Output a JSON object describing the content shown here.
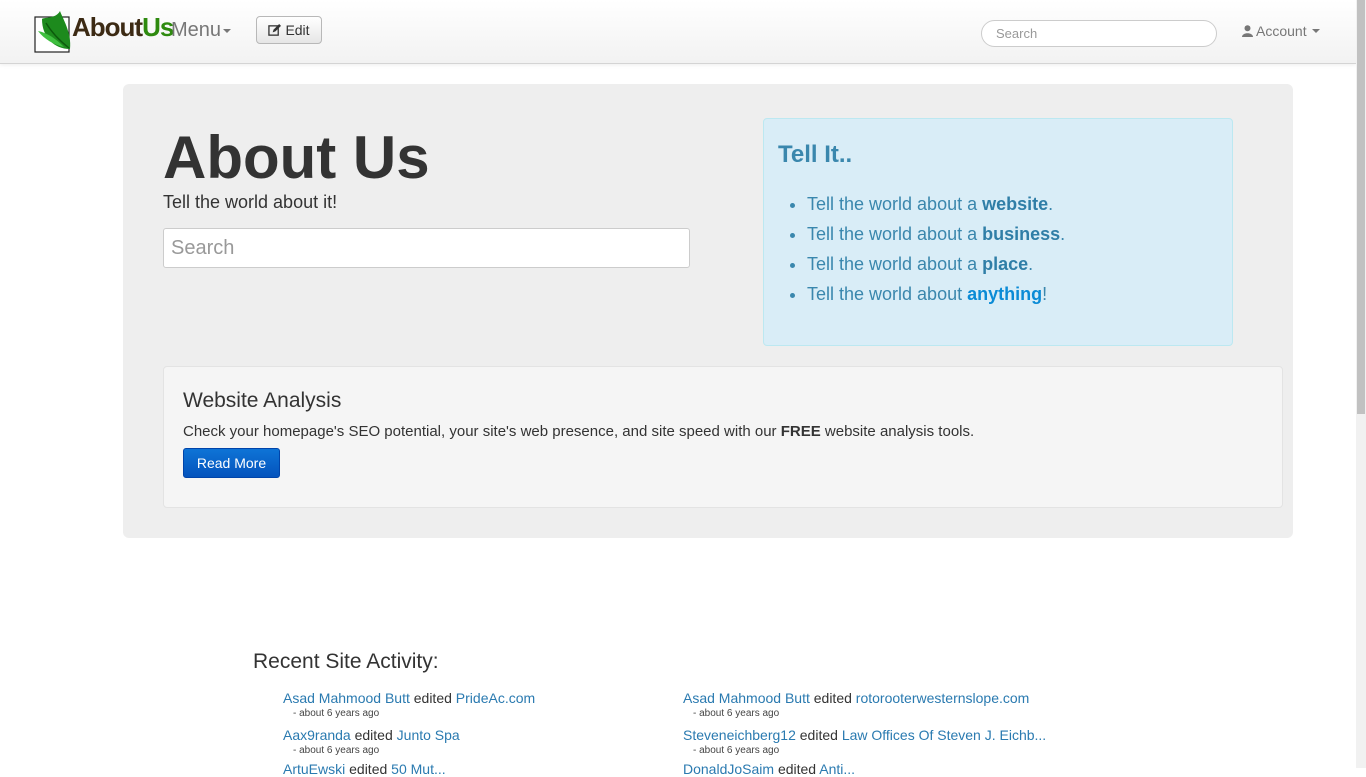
{
  "navbar": {
    "logo_about": "About",
    "logo_us": "Us",
    "menu_label": "Menu",
    "edit_label": "Edit",
    "search_placeholder": "Search",
    "account_label": "Account"
  },
  "hero": {
    "title": "About Us",
    "subtitle": "Tell the world about it!",
    "search_placeholder": "Search"
  },
  "tell_it": {
    "title": "Tell It..",
    "items": [
      {
        "prefix": "Tell the world about a ",
        "keyword": "website",
        "suffix": "."
      },
      {
        "prefix": "Tell the world about a ",
        "keyword": "business",
        "suffix": "."
      },
      {
        "prefix": "Tell the world about a ",
        "keyword": "place",
        "suffix": "."
      },
      {
        "prefix": "Tell the world about ",
        "keyword": "anything",
        "suffix": "!"
      }
    ]
  },
  "analysis": {
    "title": "Website Analysis",
    "text_before": "Check your homepage's SEO potential, your site's web presence, and site speed with our ",
    "text_bold": "FREE",
    "text_after": " website analysis tools.",
    "button_label": "Read More"
  },
  "activity": {
    "title": "Recent Site Activity:",
    "verb": "edited",
    "left": [
      {
        "user": "Asad Mahmood Butt",
        "page": "PrideAc.com",
        "time": "- about 6 years ago"
      },
      {
        "user": "Aax9randa",
        "page": "Junto Spa",
        "time": "- about 6 years ago"
      },
      {
        "user": "ArtuEwski",
        "page": "50 Mut...",
        "time": ""
      }
    ],
    "right": [
      {
        "user": "Asad Mahmood Butt",
        "page": "rotorooterwesternslope.com",
        "time": "- about 6 years ago"
      },
      {
        "user": "Steveneichberg12",
        "page": "Law Offices Of Steven J. Eichb...",
        "time": "- about 6 years ago"
      },
      {
        "user": "DonaldJoSaim",
        "page": "Anti...",
        "time": ""
      }
    ]
  },
  "colors": {
    "link": "#2a7ab0",
    "info_text": "#3a87ad",
    "info_bg": "#d9edf7",
    "button_primary": "#0453bd"
  }
}
